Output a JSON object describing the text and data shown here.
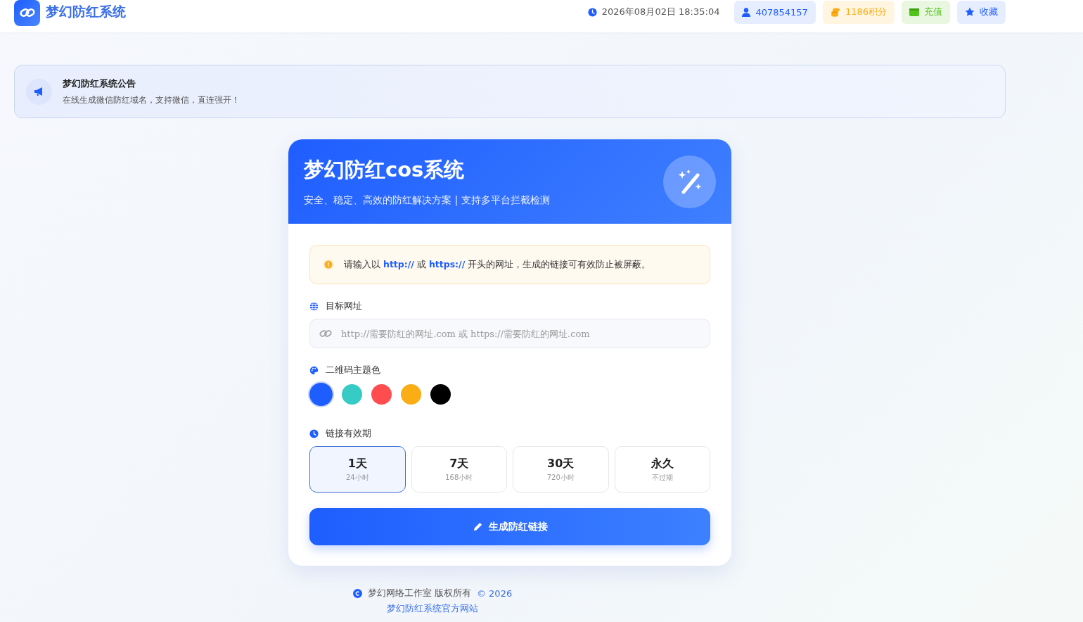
{
  "header": {
    "brand": "梦幻防红系统",
    "items": [
      {
        "kind": "clock",
        "text": "2026年08月02日 18:35:04"
      },
      {
        "kind": "user",
        "text": "407854157"
      },
      {
        "kind": "points",
        "text": "1186积分"
      },
      {
        "kind": "recharge",
        "text": "充值"
      },
      {
        "kind": "favorite",
        "text": "收藏"
      }
    ]
  },
  "notice": {
    "title": "梦幻防红系统公告",
    "text": "在线生成微信防红域名，支持微信，直连强开！"
  },
  "card": {
    "title": "梦幻防红cos系统",
    "subtitle": "安全、稳定、高效的防红解决方案 | 支持多平台拦截检测",
    "hint": "请输入以 **http://** 或 **https://** 开头的网址，生成的链接可有效防止被屏蔽。",
    "url_label": "目标网址",
    "url_placeholder": "http://需要防红的网址.com 或 https://需要防红的网址.com",
    "color_label": "二维码主题色",
    "colors": [
      {
        "color": "#1e5eff",
        "selected": true
      },
      {
        "color": "#36cbc4",
        "selected": false
      },
      {
        "color": "#ff4d4f",
        "selected": false
      },
      {
        "color": "#faad14",
        "selected": false
      },
      {
        "color": "#000000",
        "selected": false
      }
    ],
    "duration_label": "链接有效期",
    "durations": [
      {
        "label": "1天",
        "sub": "24小时",
        "selected": true
      },
      {
        "label": "7天",
        "sub": "168小时",
        "selected": false
      },
      {
        "label": "30天",
        "sub": "720小时",
        "selected": false
      },
      {
        "label": "永久",
        "sub": "不过期",
        "selected": false
      }
    ],
    "button": "生成防红链接"
  },
  "footer": {
    "owner": "梦幻网络工作室 版权所有",
    "year": "© 2026",
    "link": "梦幻防红系统官方网站"
  }
}
